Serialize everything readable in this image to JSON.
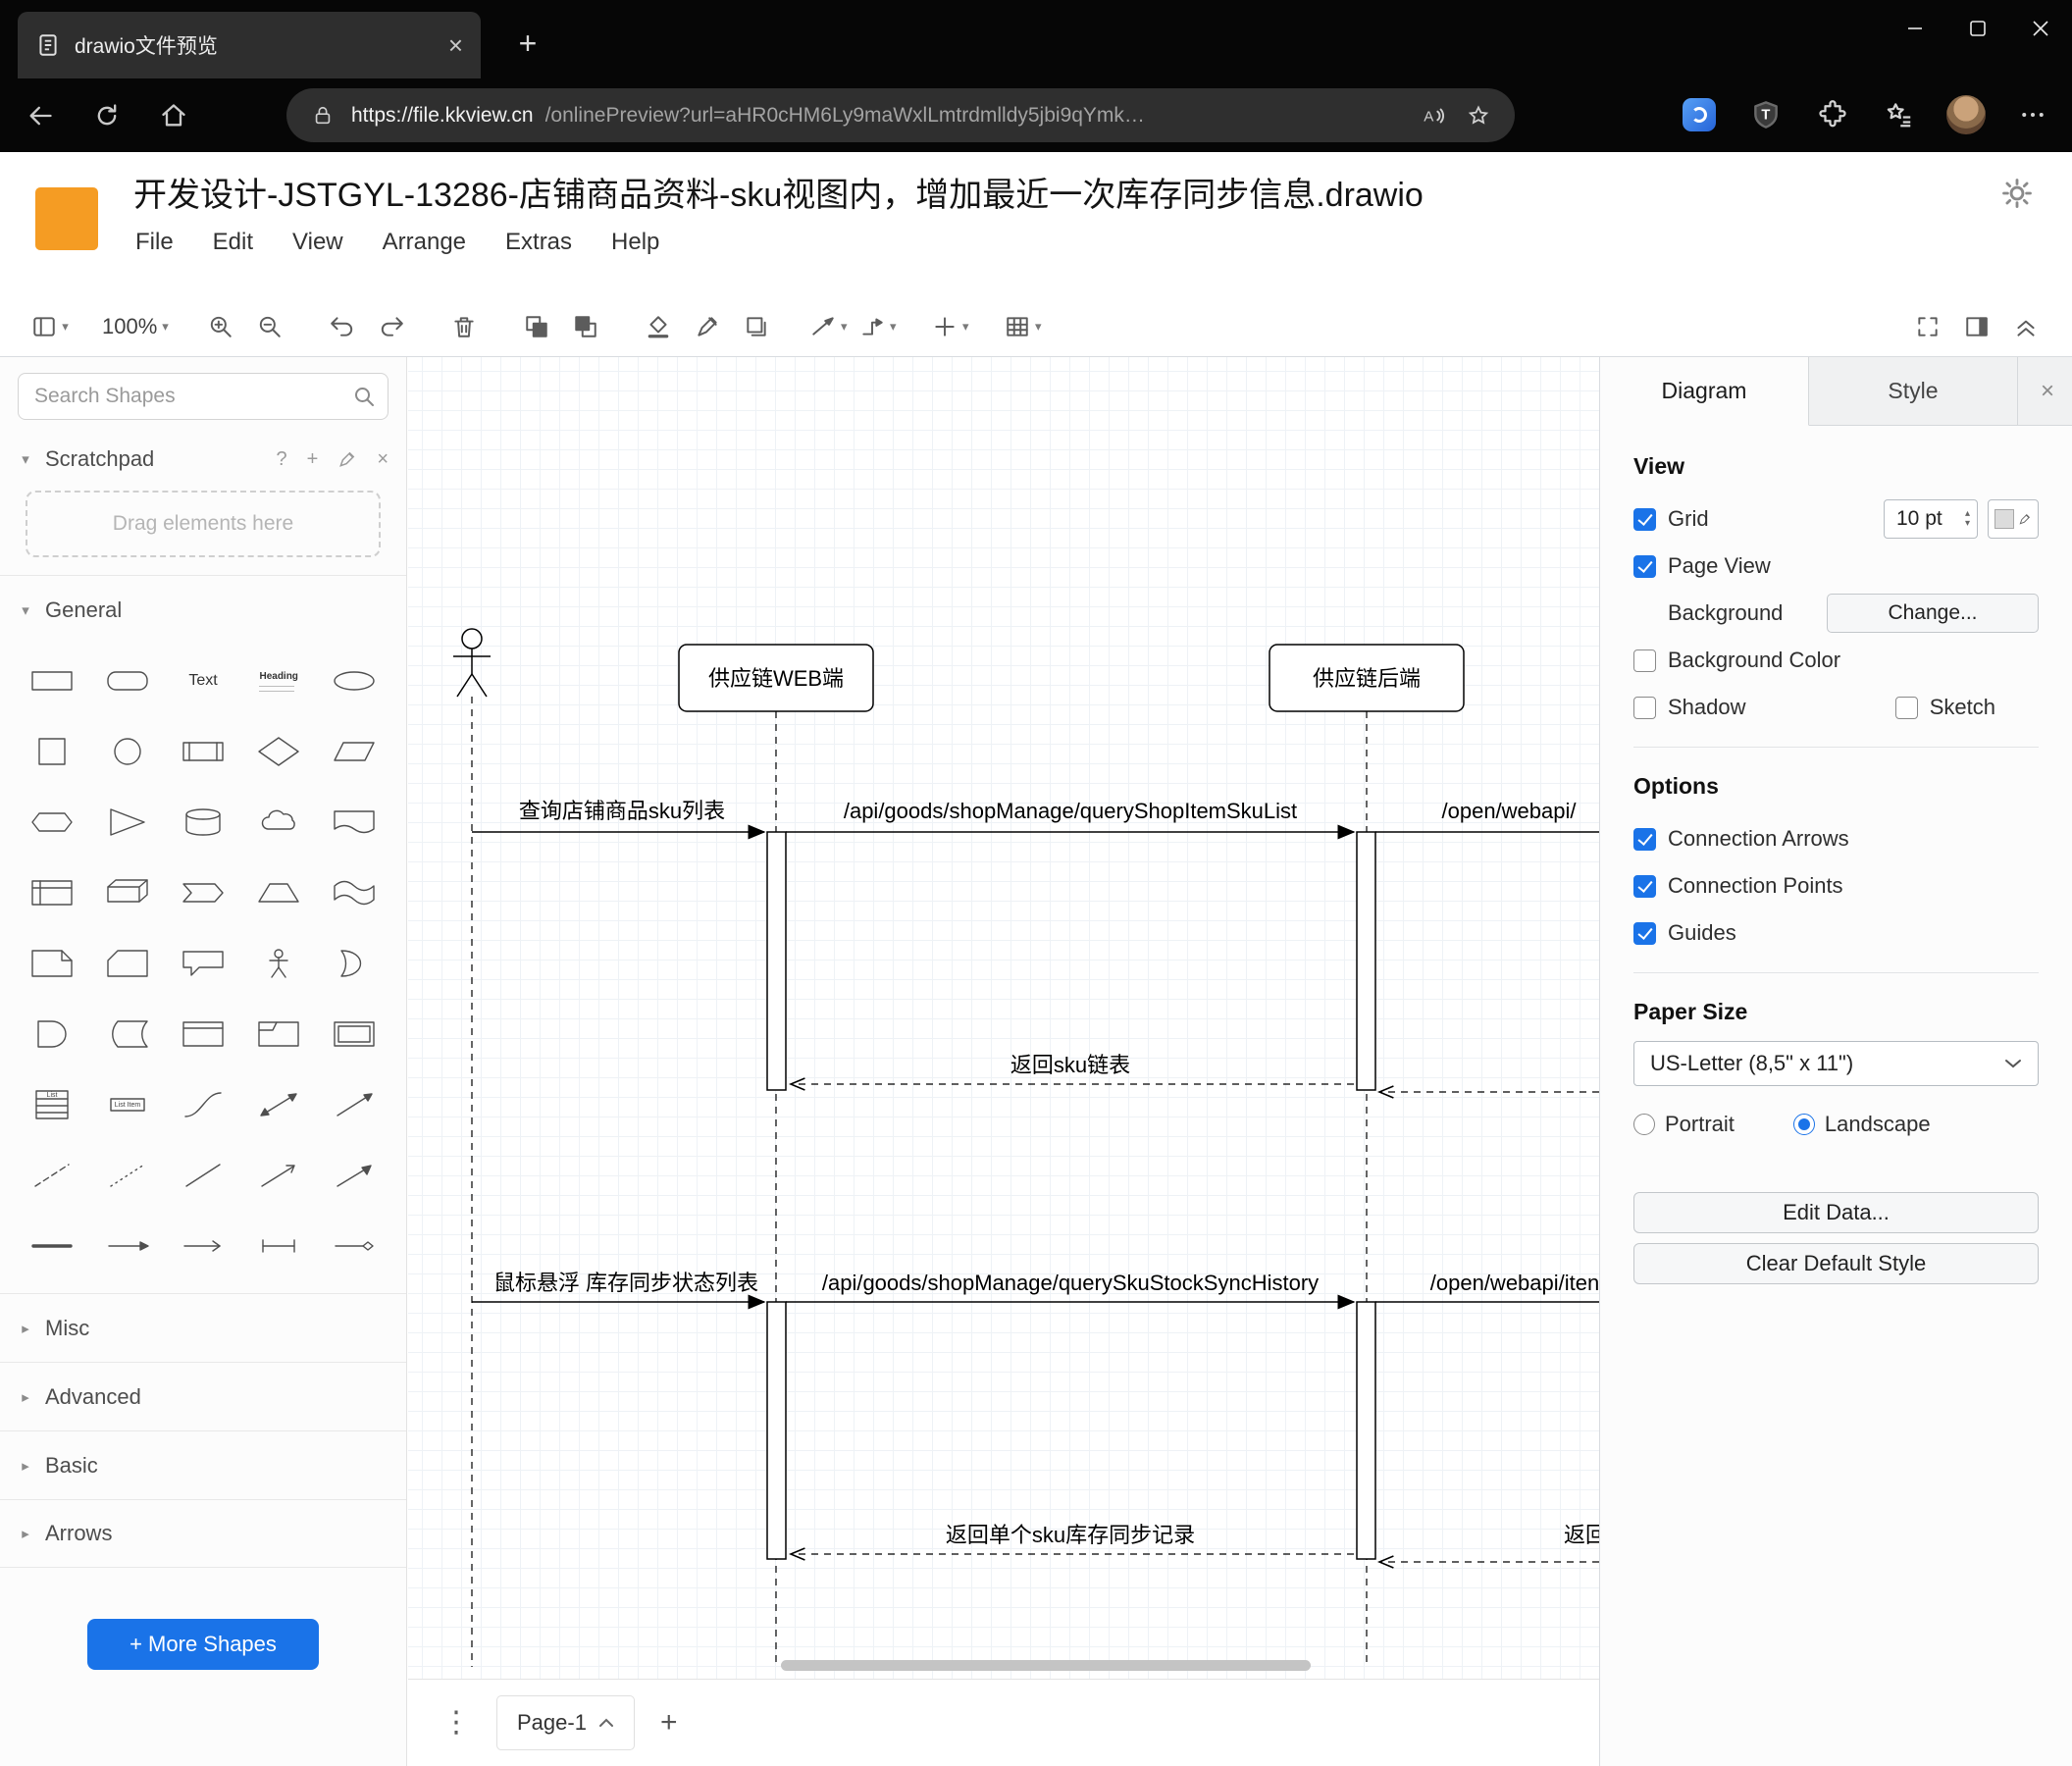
{
  "colors": {
    "accent_blue": "#1a73e8",
    "logo_orange": "#f59c23",
    "chrome_bg": "#060606",
    "grid_line": "#dde4eb"
  },
  "browser": {
    "tab_title": "drawio文件预览",
    "url_host": "https://file.kkview.cn",
    "url_path": "/onlinePreview?url=aHR0cHM6Ly9maWxlLmtrdmlldy5jbi9qYmk…"
  },
  "header": {
    "title": "开发设计-JSTGYL-13286-店铺商品资料-sku视图内，增加最近一次库存同步信息.drawio",
    "menus": [
      "File",
      "Edit",
      "View",
      "Arrange",
      "Extras",
      "Help"
    ]
  },
  "toolbar": {
    "zoom_level": "100%"
  },
  "sidebar": {
    "search_placeholder": "Search Shapes",
    "scratchpad": {
      "label": "Scratchpad",
      "hint": "Drag elements here"
    },
    "sections": {
      "general": "General",
      "misc": "Misc",
      "advanced": "Advanced",
      "basic": "Basic",
      "arrows": "Arrows"
    },
    "shape_labels": {
      "text": "Text",
      "heading": "Heading",
      "list": "List",
      "list_item": "List Item"
    },
    "more_shapes_label": "+ More Shapes"
  },
  "canvas": {
    "participants": {
      "web": "供应链WEB端",
      "backend": "供应链后端"
    },
    "messages": {
      "query_sku_list": "查询店铺商品sku列表",
      "api_query_shop_item_sku_list": "/api/goods/shopManage/queryShopItemSkuList",
      "open_webapi_1": "/open/webapi/",
      "return_sku_list": "返回sku链表",
      "hover_stock_sync": "鼠标悬浮 库存同步状态列表",
      "api_query_sku_stock_sync_history": "/api/goods/shopManage/querySkuStockSyncHistory",
      "open_webapi_2": "/open/webapi/iten",
      "return_single_sku": "返回单个sku库存同步记录",
      "return_clipped": "返回"
    }
  },
  "footer": {
    "page_tab": "Page-1"
  },
  "format_panel": {
    "tabs": {
      "diagram": "Diagram",
      "style": "Style"
    },
    "view": {
      "heading": "View",
      "grid_label": "Grid",
      "grid_size": "10 pt",
      "page_view_label": "Page View",
      "background_label": "Background",
      "change_button": "Change...",
      "background_color_label": "Background Color",
      "shadow_label": "Shadow",
      "sketch_label": "Sketch"
    },
    "options": {
      "heading": "Options",
      "connection_arrows": "Connection Arrows",
      "connection_points": "Connection Points",
      "guides": "Guides"
    },
    "paper": {
      "heading": "Paper Size",
      "size_value": "US-Letter (8,5\" x 11\")",
      "portrait": "Portrait",
      "landscape": "Landscape"
    },
    "edit_data_button": "Edit Data...",
    "clear_default_style_button": "Clear Default Style"
  }
}
